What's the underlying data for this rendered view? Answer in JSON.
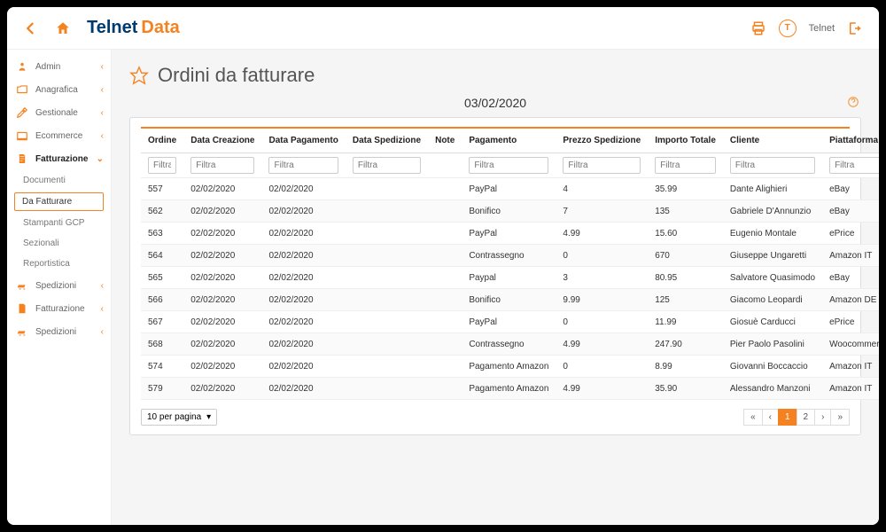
{
  "brand": {
    "part1": "Telnet",
    "part2": "Data"
  },
  "topbar": {
    "user_initial": "T",
    "user_name": "Telnet"
  },
  "sidebar": {
    "items": [
      {
        "label": "Admin"
      },
      {
        "label": "Anagrafica"
      },
      {
        "label": "Gestionale"
      },
      {
        "label": "Ecommerce"
      },
      {
        "label": "Fatturazione"
      }
    ],
    "subs": [
      {
        "label": "Documenti"
      },
      {
        "label": "Da Fatturare"
      },
      {
        "label": "Stampanti GCP"
      },
      {
        "label": "Sezionali"
      },
      {
        "label": "Reportistica"
      }
    ],
    "items2": [
      {
        "label": "Spedizioni"
      },
      {
        "label": "Fatturazione"
      },
      {
        "label": "Spedizioni"
      }
    ]
  },
  "page": {
    "title": "Ordini da fatturare",
    "date": "03/02/2020"
  },
  "columns": [
    "Ordine",
    "Data Creazione",
    "Data Pagamento",
    "Data Spedizione",
    "Note",
    "Pagamento",
    "Prezzo Spedizione",
    "Importo Totale",
    "Cliente",
    "Piattaforma"
  ],
  "filter_placeholder": "Filtra",
  "rows": [
    {
      "ord": "557",
      "dc": "02/02/2020",
      "dp": "02/02/2020",
      "ds": "",
      "note": "",
      "pag": "PayPal",
      "ps": "4",
      "it": "35.99",
      "cli": "Dante Alighieri",
      "pl": "eBay"
    },
    {
      "ord": "562",
      "dc": "02/02/2020",
      "dp": "02/02/2020",
      "ds": "",
      "note": "",
      "pag": "Bonifico",
      "ps": "7",
      "it": "135",
      "cli": "Gabriele D'Annunzio",
      "pl": "eBay"
    },
    {
      "ord": "563",
      "dc": "02/02/2020",
      "dp": "02/02/2020",
      "ds": "",
      "note": "",
      "pag": "PayPal",
      "ps": "4.99",
      "it": "15.60",
      "cli": "Eugenio Montale",
      "pl": "ePrice"
    },
    {
      "ord": "564",
      "dc": "02/02/2020",
      "dp": "02/02/2020",
      "ds": "",
      "note": "",
      "pag": "Contrassegno",
      "ps": "0",
      "it": "670",
      "cli": "Giuseppe Ungaretti",
      "pl": "Amazon IT"
    },
    {
      "ord": "565",
      "dc": "02/02/2020",
      "dp": "02/02/2020",
      "ds": "",
      "note": "",
      "pag": "Paypal",
      "ps": "3",
      "it": "80.95",
      "cli": "Salvatore Quasimodo",
      "pl": "eBay"
    },
    {
      "ord": "566",
      "dc": "02/02/2020",
      "dp": "02/02/2020",
      "ds": "",
      "note": "",
      "pag": "Bonifico",
      "ps": "9.99",
      "it": "125",
      "cli": "Giacomo Leopardi",
      "pl": "Amazon DE"
    },
    {
      "ord": "567",
      "dc": "02/02/2020",
      "dp": "02/02/2020",
      "ds": "",
      "note": "",
      "pag": "PayPal",
      "ps": "0",
      "it": "11.99",
      "cli": "Giosuè Carducci",
      "pl": "ePrice"
    },
    {
      "ord": "568",
      "dc": "02/02/2020",
      "dp": "02/02/2020",
      "ds": "",
      "note": "",
      "pag": "Contrassegno",
      "ps": "4.99",
      "it": "247.90",
      "cli": "Pier Paolo Pasolini",
      "pl": "Woocommerce"
    },
    {
      "ord": "574",
      "dc": "02/02/2020",
      "dp": "02/02/2020",
      "ds": "",
      "note": "",
      "pag": "Pagamento Amazon",
      "ps": "0",
      "it": "8.99",
      "cli": "Giovanni Boccaccio",
      "pl": "Amazon IT"
    },
    {
      "ord": "579",
      "dc": "02/02/2020",
      "dp": "02/02/2020",
      "ds": "",
      "note": "",
      "pag": "Pagamento Amazon",
      "ps": "4.99",
      "it": "35.90",
      "cli": "Alessandro Manzoni",
      "pl": "Amazon IT"
    }
  ],
  "per_page": "10 per pagina",
  "pager": {
    "pages": [
      "1",
      "2"
    ],
    "active": "1"
  }
}
